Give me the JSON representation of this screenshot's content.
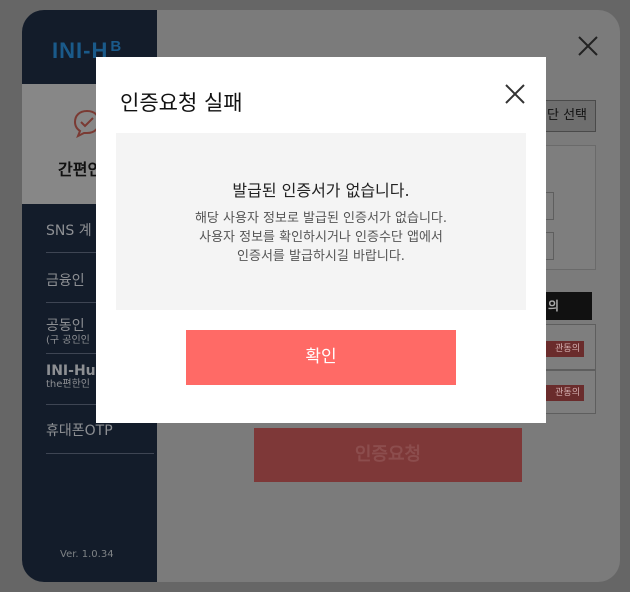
{
  "background_window": {
    "logo": "INI-HB",
    "sidebar": {
      "active_item_label": "간편인",
      "items": [
        {
          "label": "SNS 계"
        },
        {
          "label": "금융인"
        },
        {
          "label": "공동인",
          "sub": "(구 공인인"
        },
        {
          "label": "INI-Hu",
          "sub": "the편한인"
        },
        {
          "label": "휴대폰OTP"
        }
      ],
      "version": "Ver. 1.0.34"
    },
    "select_button_label": "단 선택",
    "agree_header": "의",
    "agree_tag_1": "관동의",
    "agree_tag_2": "관동의",
    "request_button_label": "인증요청"
  },
  "modal": {
    "title": "인증요청 실패",
    "message_heading": "발급된 인증서가 없습니다.",
    "message_lines": [
      "해당 사용자 정보로 발급된 인증서가 없습니다.",
      "사용자 정보를 확인하시거나 인증수단 앱에서",
      "인증서를 발급하시길 바랍니다."
    ],
    "confirm_label": "확인"
  },
  "colors": {
    "overlay": "#666666",
    "sidebar": "#131c2a",
    "confirm_button": "#ff6a66",
    "message_box": "#f4f4f4"
  }
}
